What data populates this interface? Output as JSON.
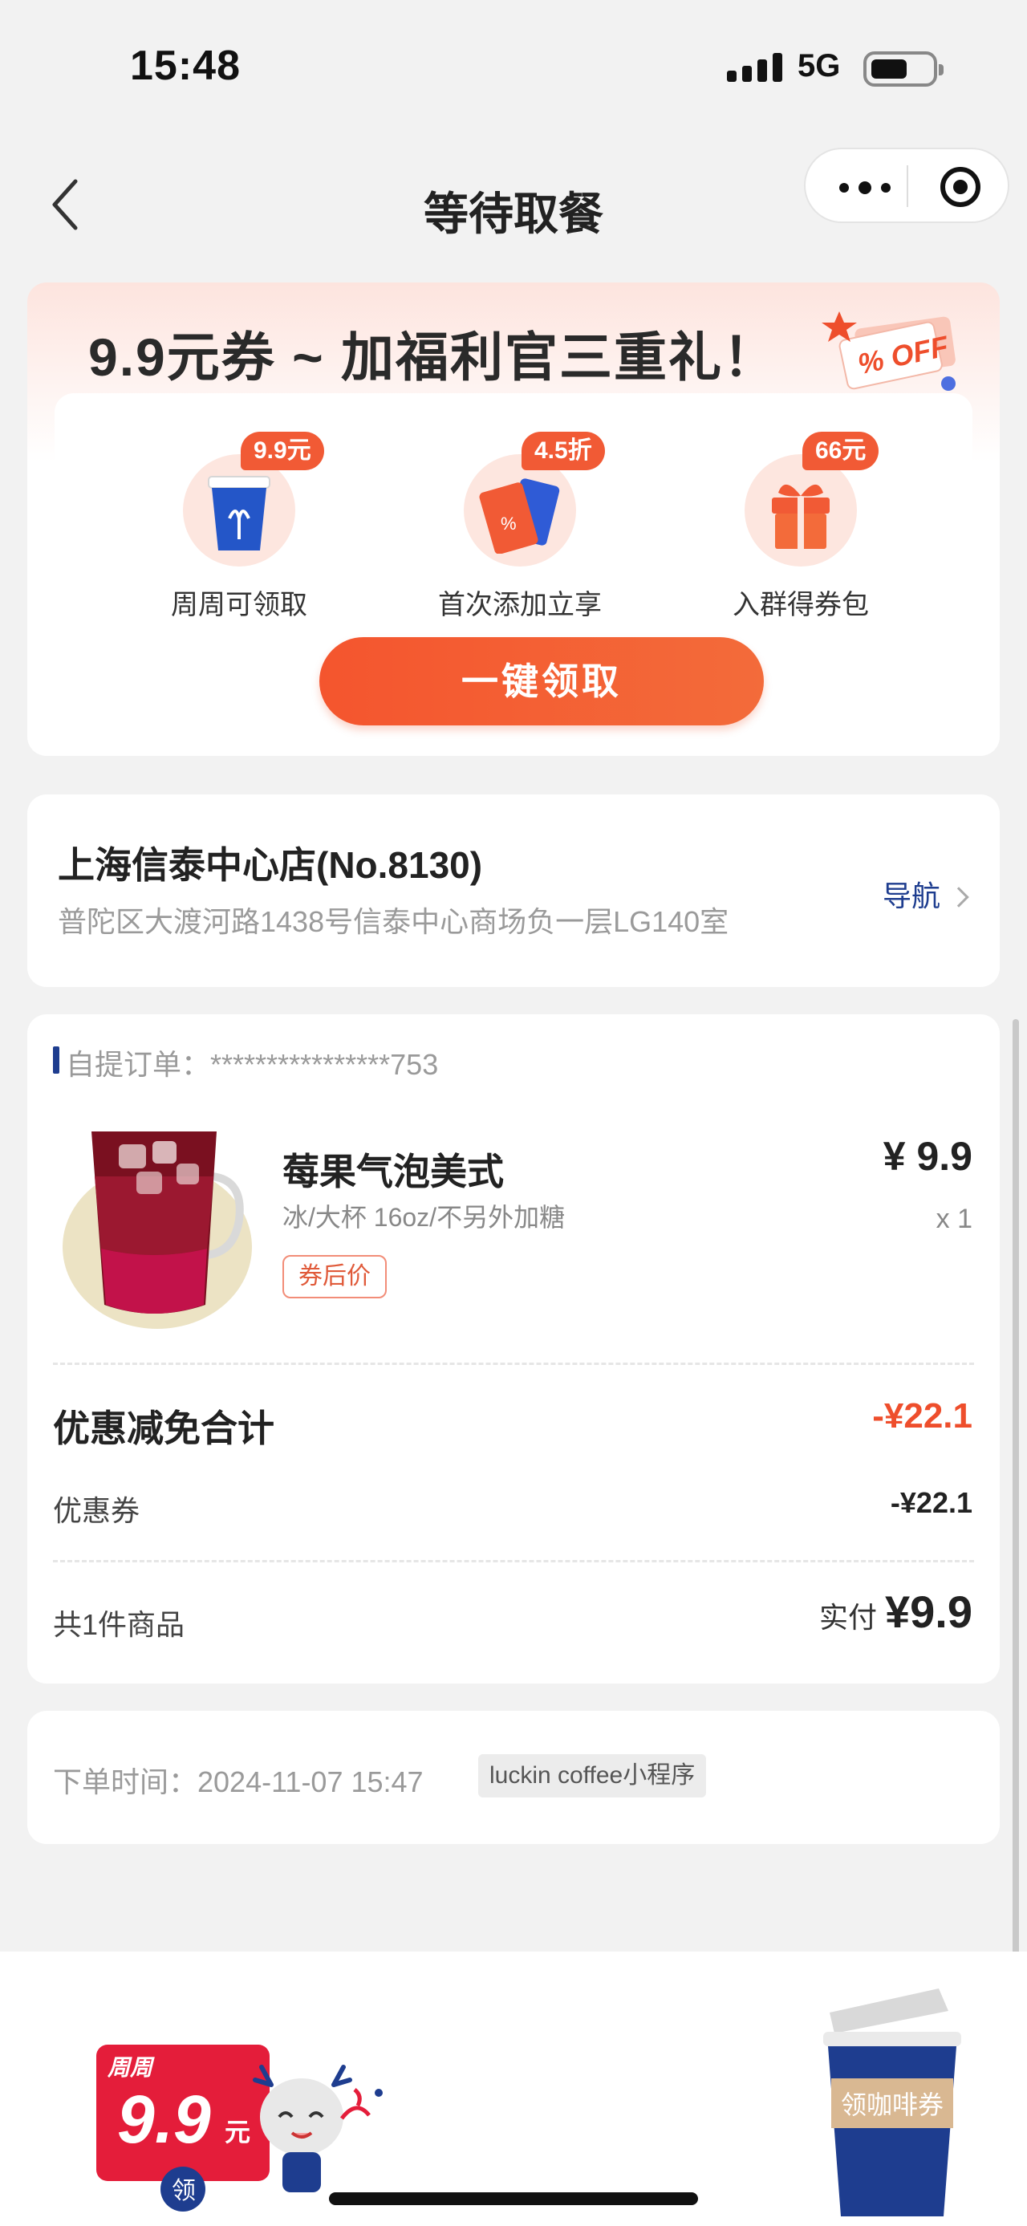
{
  "status_bar": {
    "time": "15:48",
    "network": "5G"
  },
  "nav": {
    "title": "等待取餐"
  },
  "promo": {
    "title": "9.9元券 ~ 加福利官三重礼！",
    "off_tag": "% OFF",
    "benefits": [
      {
        "badge": "9.9元",
        "label": "周周可领取",
        "icon": "coffee-cup-icon"
      },
      {
        "badge": "4.5折",
        "label": "首次添加立享",
        "icon": "ticket-icon"
      },
      {
        "badge": "66元",
        "label": "入群得券包",
        "icon": "gift-box-icon"
      }
    ],
    "button": "一键领取",
    "accent_color": "#f15a35"
  },
  "store": {
    "name": "上海信泰中心店(No.8130)",
    "address": "普陀区大渡河路1438号信泰中心商场负一层LG140室",
    "navigate": "导航"
  },
  "order": {
    "header": "自提订单：****************753",
    "item": {
      "name": "莓果气泡美式",
      "spec": "冰/大杯 16oz/不另外加糖",
      "tag": "券后价",
      "price": "¥ 9.9",
      "quantity": "x 1"
    },
    "discount_title": "优惠减免合计",
    "discount_total": "-¥22.1",
    "coupon_label": "优惠券",
    "coupon_value": "-¥22.1",
    "count": "共1件商品",
    "paid_label": "实付",
    "paid_value": "¥9.9"
  },
  "order_info": {
    "time": "下单时间：2024-11-07 15:47",
    "channel": "luckin coffee小程序"
  },
  "bottom": {
    "week_label": "周周",
    "week_price": "9.9",
    "week_unit": "元",
    "claim": "领",
    "cup_label": "领咖啡券"
  }
}
